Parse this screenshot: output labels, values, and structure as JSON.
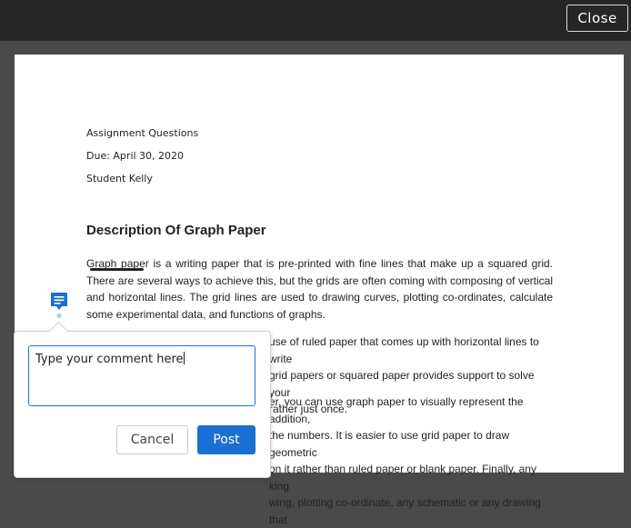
{
  "header": {
    "close_label": "Close"
  },
  "document": {
    "meta": {
      "assignment": "Assignment Questions",
      "due": "Due:  April 30, 2020",
      "student": "Student Kelly"
    },
    "title": "Description Of Graph Paper",
    "paragraph1": {
      "highlight": "Graph paper",
      "rest": " is a writing paper that is pre-printed with fine lines that make up a squared grid. There are several ways to achieve this, but the grids are often coming with composing of vertical and horizontal lines. The grid lines are used to drawing curves, plotting co-ordinates, calculate some experimental data, and functions of graphs."
    },
    "paragraph2_lines": [
      "use of ruled paper that comes up with horizontal lines to write",
      "grid papers or squared paper provides support to solve your",
      "rather just once."
    ],
    "paragraph3_lines": [
      "er, you can use graph paper to visually represent the addition,",
      "the numbers. It is easier to use grid paper to draw geometric",
      "on it rather than ruled paper or blank paper. Finally, any king",
      "wing, plotting co-ordinate, any schematic or any drawing that"
    ]
  },
  "comment": {
    "text": "Type your comment here",
    "cancel_label": "Cancel",
    "post_label": "Post",
    "accent_color": "#1a6fd2"
  }
}
